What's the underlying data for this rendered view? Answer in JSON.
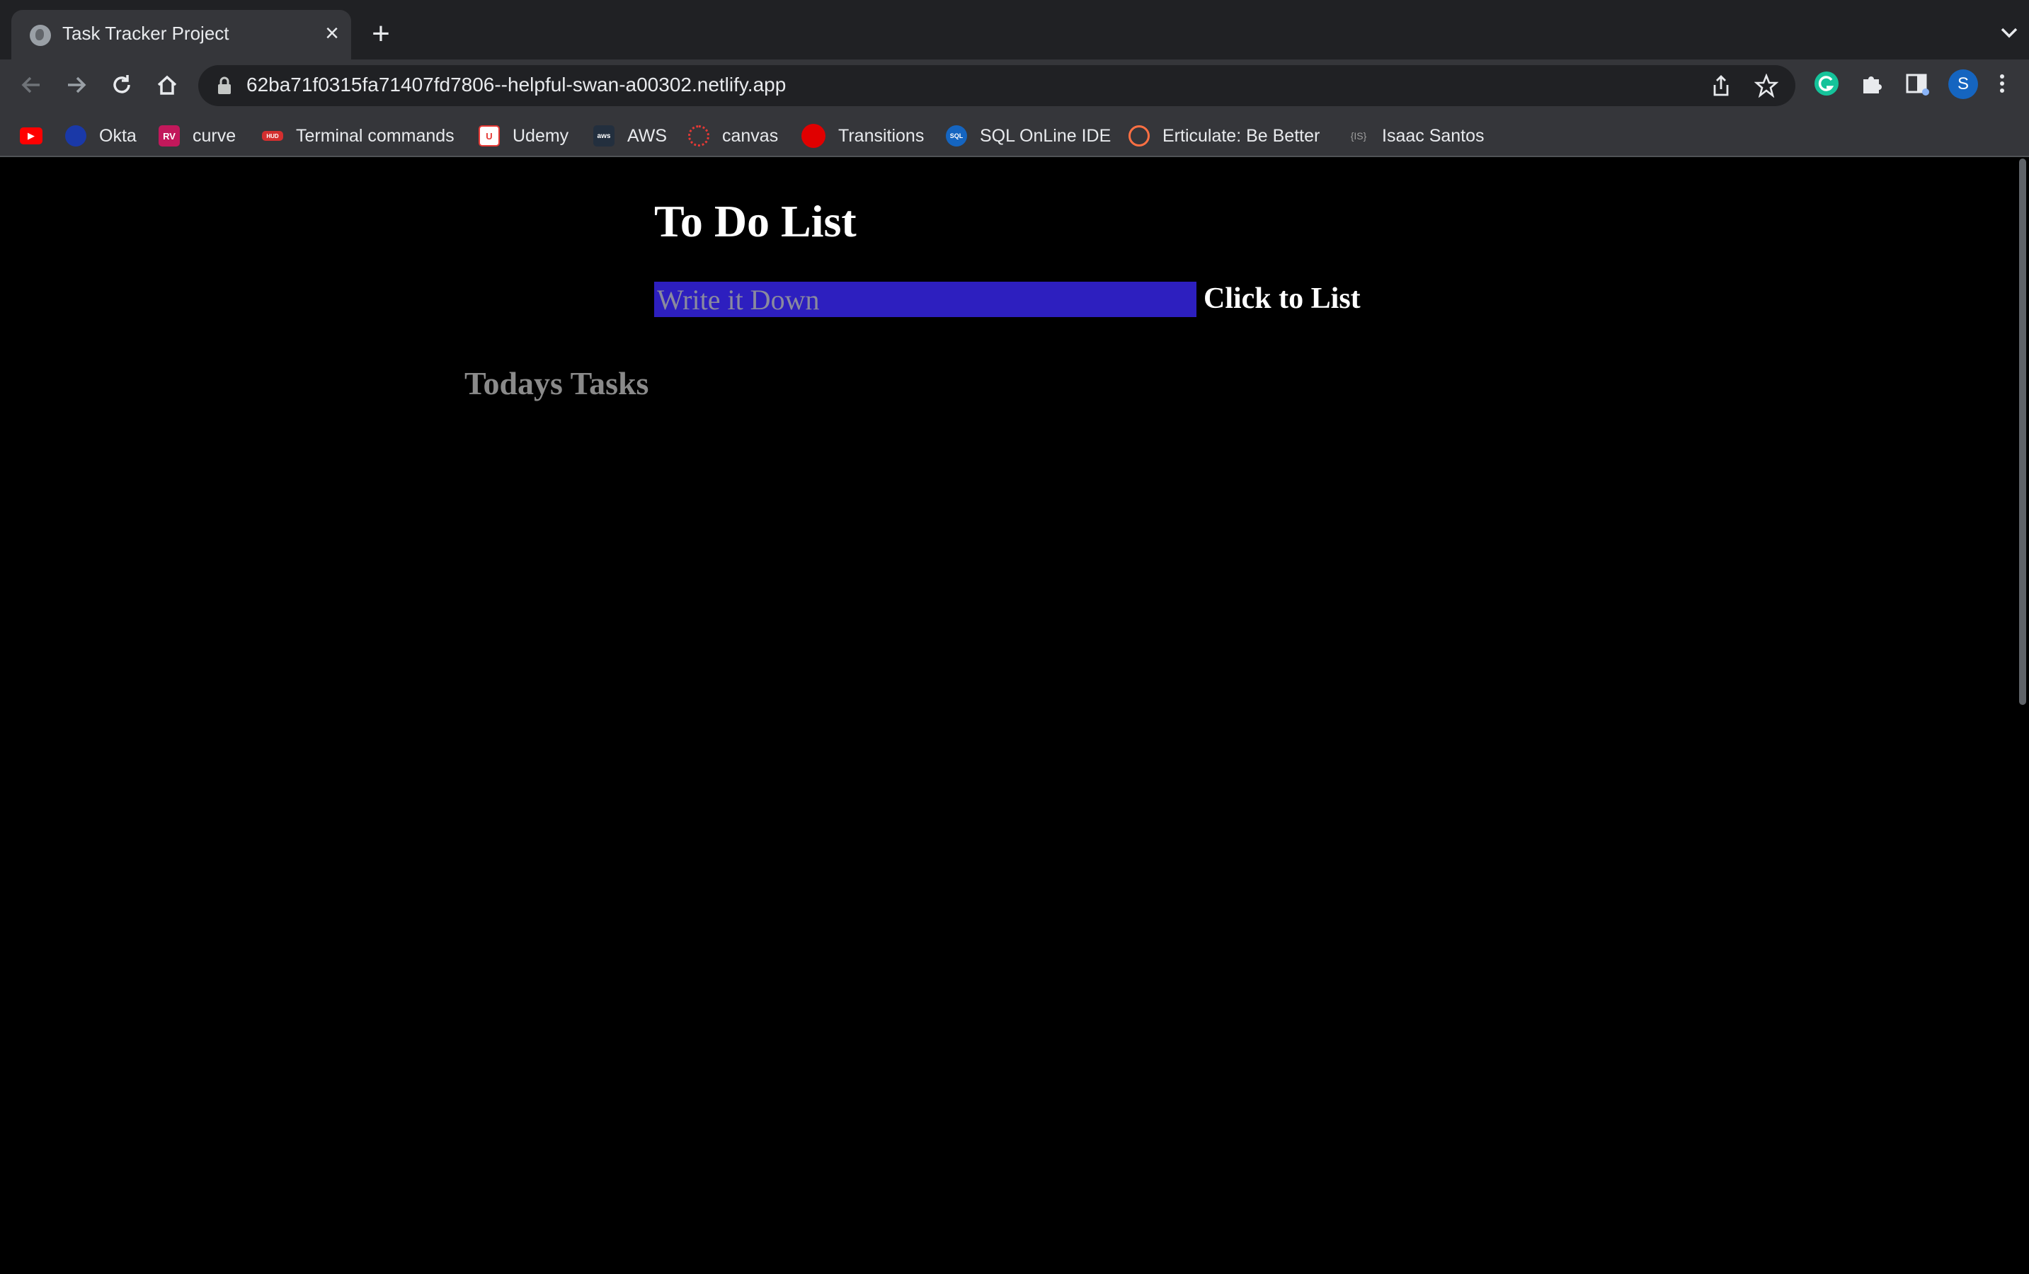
{
  "browser": {
    "tab": {
      "title": "Task Tracker Project"
    },
    "address_bar": {
      "url": "62ba71f0315fa71407fd7806--helpful-swan-a00302.netlify.app"
    },
    "profile_initial": "S",
    "bookmarks": [
      {
        "label": "",
        "icon": "youtube-icon",
        "color": "#ff0000"
      },
      {
        "label": "Okta",
        "icon": "okta-icon",
        "color": "#1a39a8"
      },
      {
        "label": "curve",
        "icon": "curve-icon",
        "color": "#c2185b"
      },
      {
        "label": "Terminal commands",
        "icon": "terminal-icon",
        "color": "#d32f2f"
      },
      {
        "label": "Udemy",
        "icon": "udemy-icon",
        "color": "#e53935"
      },
      {
        "label": "AWS",
        "icon": "aws-icon",
        "color": "#232f3e"
      },
      {
        "label": "canvas",
        "icon": "canvas-icon",
        "color": "#e53935"
      },
      {
        "label": "Transitions",
        "icon": "transitions-icon",
        "color": "#e00000"
      },
      {
        "label": "SQL OnLine IDE",
        "icon": "sql-icon",
        "color": "#1565c0"
      },
      {
        "label": "Erticulate: Be Better",
        "icon": "erticulate-icon",
        "color": "#ff7043"
      },
      {
        "label": "Isaac Santos",
        "icon": "isaac-santos-icon",
        "color": "#9e9e9e"
      }
    ]
  },
  "app": {
    "title": "To Do List",
    "input": {
      "placeholder": "Write it Down",
      "value": ""
    },
    "add_button": "Click to List",
    "tasks_heading": "Todays Tasks",
    "colors": {
      "background": "#000000",
      "input_background": "#2d1fbf"
    }
  }
}
